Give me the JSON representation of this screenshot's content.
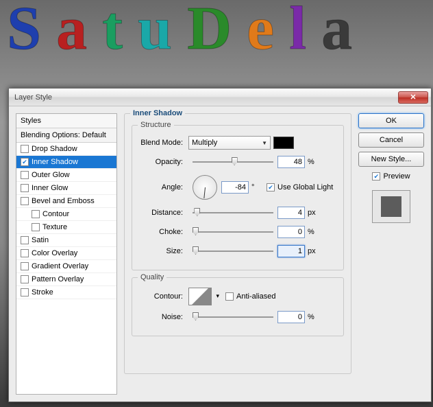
{
  "background_text": [
    {
      "char": "S",
      "color": "#1e3fae"
    },
    {
      "char": "a",
      "color": "#b82020"
    },
    {
      "char": "t",
      "color": "#1a9e60"
    },
    {
      "char": "u",
      "color": "#1aa8a8"
    },
    {
      "char": "D",
      "color": "#2a8a2a"
    },
    {
      "char": "e",
      "color": "#e07a1a"
    },
    {
      "char": "l",
      "color": "#7a2aa8"
    },
    {
      "char": "a",
      "color": "#3a3a3a"
    }
  ],
  "dialog": {
    "title": "Layer Style",
    "left": {
      "header": "Styles",
      "subheader": "Blending Options: Default",
      "items": [
        {
          "label": "Drop Shadow",
          "checked": false,
          "selected": false,
          "indent": false
        },
        {
          "label": "Inner Shadow",
          "checked": true,
          "selected": true,
          "indent": false
        },
        {
          "label": "Outer Glow",
          "checked": false,
          "selected": false,
          "indent": false
        },
        {
          "label": "Inner Glow",
          "checked": false,
          "selected": false,
          "indent": false
        },
        {
          "label": "Bevel and Emboss",
          "checked": false,
          "selected": false,
          "indent": false
        },
        {
          "label": "Contour",
          "checked": false,
          "selected": false,
          "indent": true
        },
        {
          "label": "Texture",
          "checked": false,
          "selected": false,
          "indent": true
        },
        {
          "label": "Satin",
          "checked": false,
          "selected": false,
          "indent": false
        },
        {
          "label": "Color Overlay",
          "checked": false,
          "selected": false,
          "indent": false
        },
        {
          "label": "Gradient Overlay",
          "checked": false,
          "selected": false,
          "indent": false
        },
        {
          "label": "Pattern Overlay",
          "checked": false,
          "selected": false,
          "indent": false
        },
        {
          "label": "Stroke",
          "checked": false,
          "selected": false,
          "indent": false
        }
      ]
    },
    "main": {
      "title": "Inner Shadow",
      "structure": {
        "title": "Structure",
        "blend_mode_label": "Blend Mode:",
        "blend_mode_value": "Multiply",
        "color": "#000000",
        "opacity_label": "Opacity:",
        "opacity_value": "48",
        "opacity_unit": "%",
        "angle_label": "Angle:",
        "angle_value": "-84",
        "angle_unit": "°",
        "global_light_checked": true,
        "global_light_label": "Use Global Light",
        "distance_label": "Distance:",
        "distance_value": "4",
        "distance_unit": "px",
        "choke_label": "Choke:",
        "choke_value": "0",
        "choke_unit": "%",
        "size_label": "Size:",
        "size_value": "1",
        "size_unit": "px"
      },
      "quality": {
        "title": "Quality",
        "contour_label": "Contour:",
        "anti_aliased_label": "Anti-aliased",
        "anti_aliased_checked": false,
        "noise_label": "Noise:",
        "noise_value": "0",
        "noise_unit": "%"
      }
    },
    "right": {
      "ok": "OK",
      "cancel": "Cancel",
      "new_style": "New Style...",
      "preview_label": "Preview",
      "preview_checked": true
    }
  }
}
